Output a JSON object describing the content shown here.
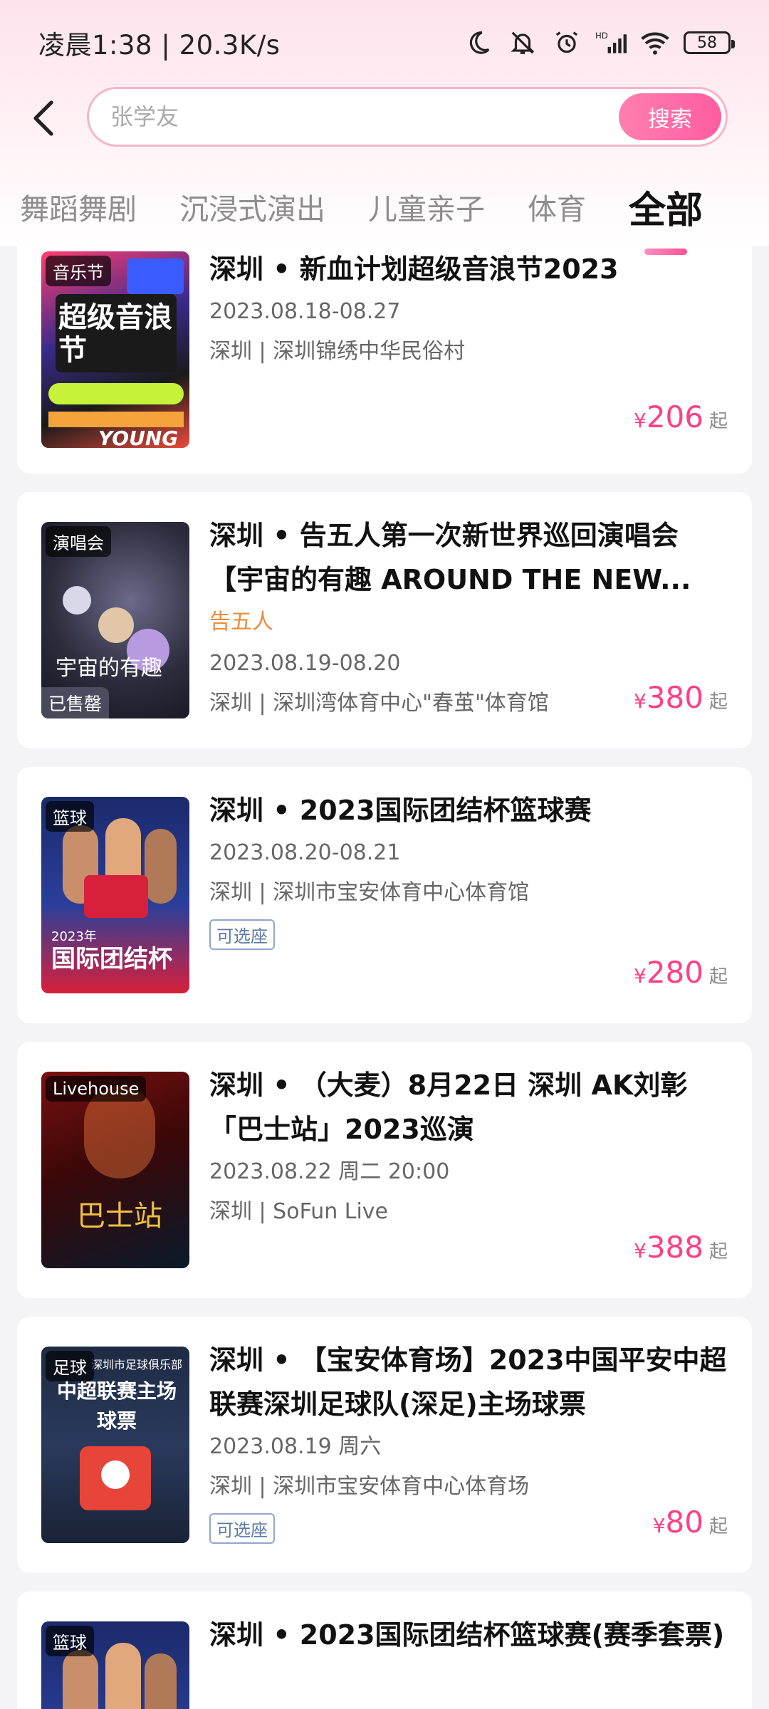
{
  "status": {
    "time": "凌晨1:38 | 20.3K/s",
    "battery": "58",
    "network": "HD"
  },
  "search": {
    "placeholder": "张学友",
    "button_label": "搜索"
  },
  "tabs": [
    "舞蹈舞剧",
    "沉浸式演出",
    "儿童亲子",
    "体育",
    "全部"
  ],
  "active_tab": "全部",
  "events": [
    {
      "category": "音乐节",
      "title": "深圳 • 新血计划超级音浪节2023",
      "artist": "",
      "date": "2023.08.18-08.27",
      "venue": "深圳 | 深圳锦绣中华民俗村",
      "seat_tag": "",
      "sold_out": "",
      "price": "206",
      "poster_text": "超级音浪节",
      "poster_sub": "YOUNG"
    },
    {
      "category": "演唱会",
      "title": "深圳 • 告五人第一次新世界巡回演唱会 【宇宙的有趣 AROUND THE NEW...",
      "artist": "告五人",
      "date": "2023.08.19-08.20",
      "venue": "深圳 | 深圳湾体育中心\"春茧\"体育馆",
      "seat_tag": "",
      "sold_out": "已售罄",
      "price": "380",
      "poster_text": "宇宙的有趣",
      "poster_sub": ""
    },
    {
      "category": "篮球",
      "title": "深圳 • 2023国际团结杯篮球赛",
      "artist": "",
      "date": "2023.08.20-08.21",
      "venue": "深圳 | 深圳市宝安体育中心体育馆",
      "seat_tag": "可选座",
      "sold_out": "",
      "price": "280",
      "poster_text": "国际团结杯",
      "poster_sub": "2023年"
    },
    {
      "category": "Livehouse",
      "title": "深圳 • （大麦）8月22日 深圳 AK刘彰「巴士站」2023巡演",
      "artist": "",
      "date": "2023.08.22 周二 20:00",
      "venue": "深圳 | SoFun Live",
      "seat_tag": "",
      "sold_out": "",
      "price": "388",
      "poster_text": "巴士站",
      "poster_sub": ""
    },
    {
      "category": "足球",
      "title": "深圳 • 【宝安体育场】2023中国平安中超联赛深圳足球队(深足)主场球票",
      "artist": "",
      "date": "2023.08.19 周六",
      "venue": "深圳 | 深圳市宝安体育中心体育场",
      "seat_tag": "可选座",
      "sold_out": "",
      "price": "80",
      "poster_text": "中超联赛主场球票",
      "poster_sub": "深圳市足球俱乐部"
    },
    {
      "category": "篮球",
      "title": "深圳 • 2023国际团结杯篮球赛(赛季套票)",
      "artist": "",
      "date": "",
      "venue": "",
      "seat_tag": "",
      "sold_out": "",
      "price": "",
      "poster_text": "",
      "poster_sub": ""
    }
  ],
  "price_suffix": "起",
  "currency": "¥",
  "colors": {
    "accent": "#ff3f84",
    "search_border": "#f7b4ca",
    "artist": "#f08a3c"
  }
}
